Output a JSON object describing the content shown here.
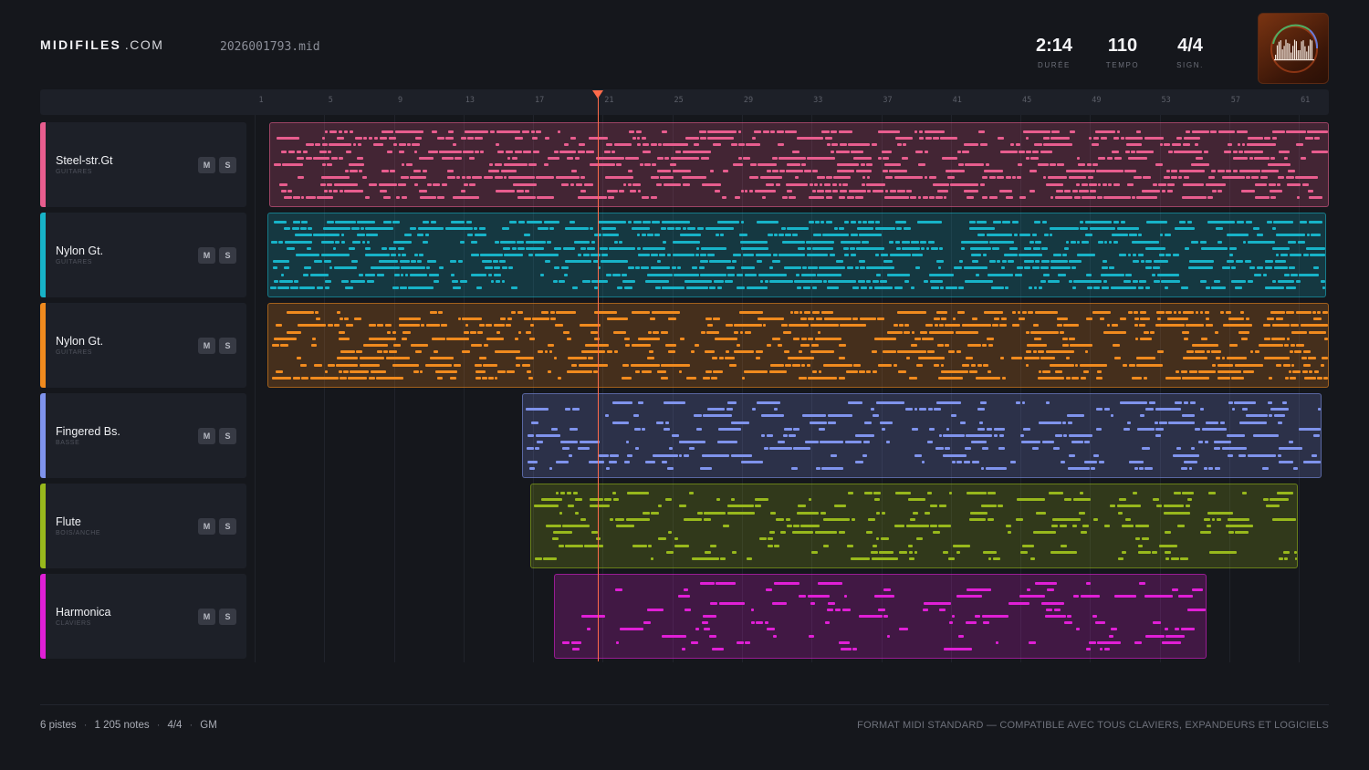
{
  "header": {
    "brand_bold": "MIDIFILES",
    "brand_suffix": ".COM",
    "filename": "2026001793.mid",
    "stats": [
      {
        "value": "2:14",
        "label": "DURÉE"
      },
      {
        "value": "110",
        "label": "TEMPO"
      },
      {
        "value": "4/4",
        "label": "SIGN."
      }
    ]
  },
  "ruler": {
    "ticks": [
      "1",
      "5",
      "9",
      "13",
      "17",
      "21",
      "25",
      "29",
      "33",
      "37",
      "41",
      "45",
      "49",
      "53",
      "57",
      "61"
    ]
  },
  "tracks": [
    {
      "name": "Steel-str.Gt",
      "category": "GUITARES",
      "color": "#e85d8e",
      "mute": "M",
      "solo": "S"
    },
    {
      "name": "Nylon Gt.",
      "category": "GUITARES",
      "color": "#17b3c8",
      "mute": "M",
      "solo": "S"
    },
    {
      "name": "Nylon Gt.",
      "category": "GUITARES",
      "color": "#f08a1e",
      "mute": "M",
      "solo": "S"
    },
    {
      "name": "Fingered Bs.",
      "category": "BASSE",
      "color": "#7f93ec",
      "mute": "M",
      "solo": "S"
    },
    {
      "name": "Flute",
      "category": "BOIS/ANCHE",
      "color": "#98b81c",
      "mute": "M",
      "solo": "S"
    },
    {
      "name": "Harmonica",
      "category": "CLAVIERS",
      "color": "#e01fd6",
      "mute": "M",
      "solo": "S"
    }
  ],
  "footer": {
    "tracks": "6 pistes",
    "notes": "1 205 notes",
    "signature": "4/4",
    "standard": "GM",
    "format_note": "FORMAT MIDI STANDARD — COMPATIBLE AVEC TOUS CLAVIERS, EXPANDEURS ET LOGICIELS"
  },
  "playhead": {
    "position_bar": 20.5
  }
}
